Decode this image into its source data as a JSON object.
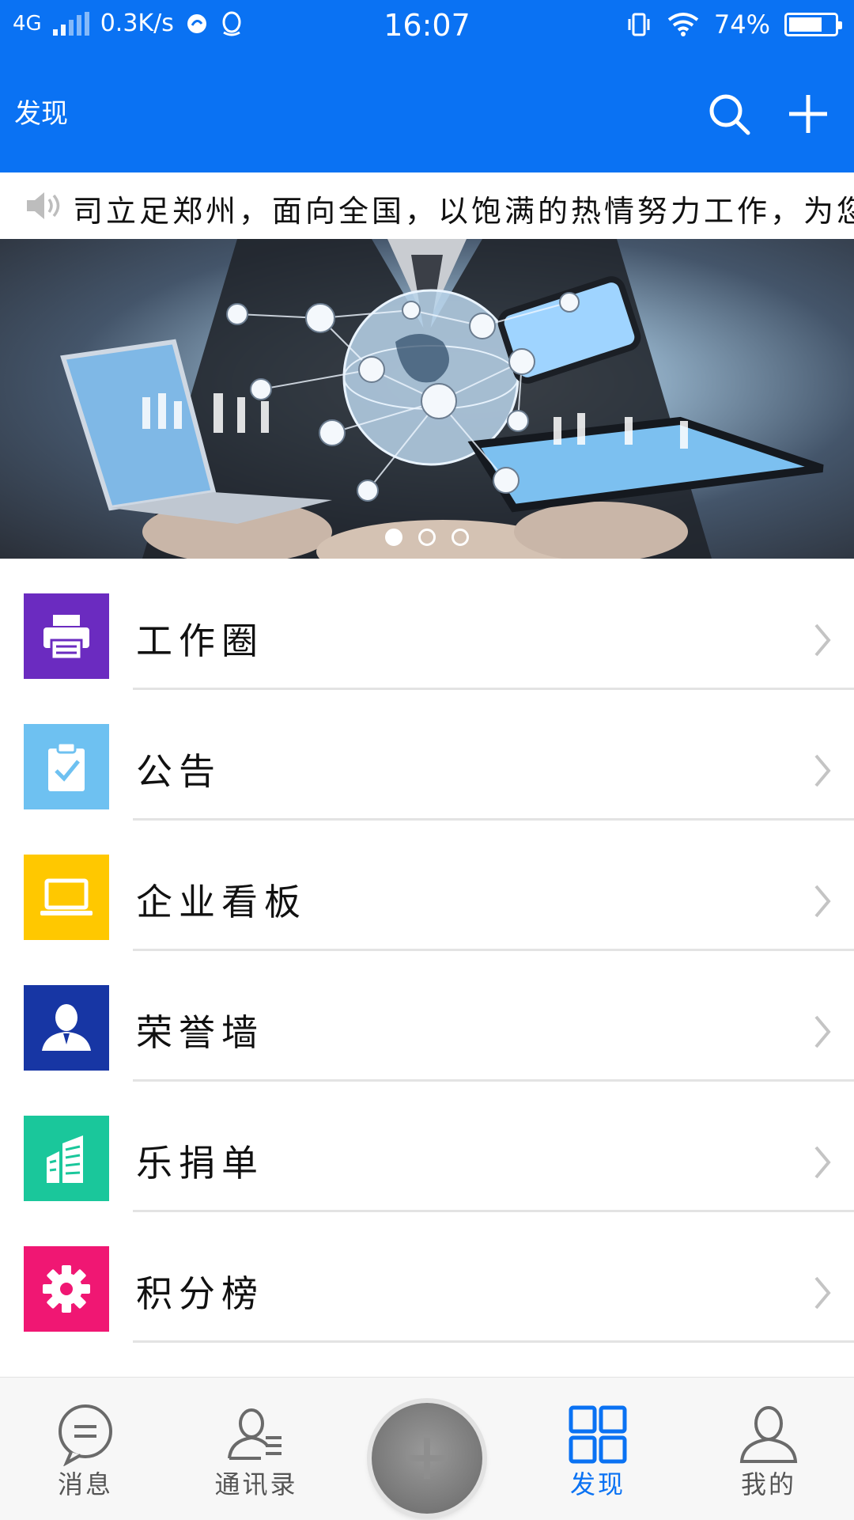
{
  "status_bar": {
    "network": "4G",
    "speed": "0.3K/s",
    "time": "16:07",
    "battery_percent": "74%",
    "battery_level": 0.74
  },
  "app_bar": {
    "title": "发现",
    "search_icon": "search-icon",
    "add_icon": "plus-icon"
  },
  "marquee": {
    "text": "司立足郑州，面向全国，以饱满的热情努力工作，为您"
  },
  "banner": {
    "slide_count": 3,
    "active_index": 0
  },
  "menu": [
    {
      "label": "工作圈",
      "icon": "printer-icon",
      "color": "#6b2bc0"
    },
    {
      "label": "公告",
      "icon": "clipboard-check-icon",
      "color": "#6ec1f1"
    },
    {
      "label": "企业看板",
      "icon": "laptop-icon",
      "color": "#ffc800"
    },
    {
      "label": "荣誉墙",
      "icon": "person-icon",
      "color": "#1736a4"
    },
    {
      "label": "乐捐单",
      "icon": "building-icon",
      "color": "#1ac79b"
    },
    {
      "label": "积分榜",
      "icon": "gear-icon",
      "color": "#f01773"
    }
  ],
  "bottom_nav": [
    {
      "label": "消息",
      "icon": "message-icon",
      "active": false
    },
    {
      "label": "通讯录",
      "icon": "contacts-icon",
      "active": false
    },
    {
      "label": "发现",
      "icon": "grid-icon",
      "active": true
    },
    {
      "label": "我的",
      "icon": "profile-icon",
      "active": false
    }
  ],
  "colors": {
    "primary": "#0a72f3",
    "nav_inactive": "#555555"
  }
}
